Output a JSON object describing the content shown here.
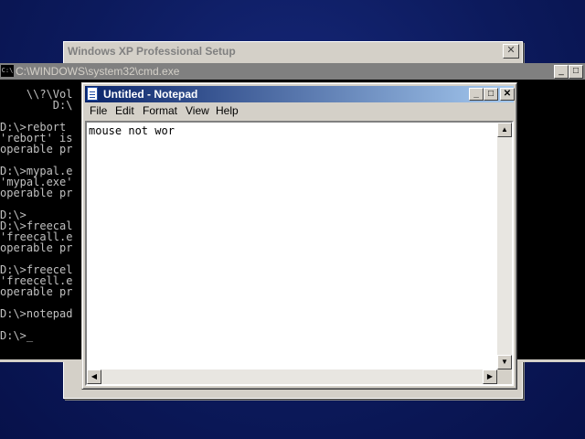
{
  "setup_window": {
    "title": "Windows XP Professional Setup",
    "close_glyph": "✕"
  },
  "cmd_window": {
    "icon_text": "C:\\",
    "title": "C:\\WINDOWS\\system32\\cmd.exe",
    "lines": [
      "    \\\\?\\Vol",
      "        D:\\",
      "",
      "D:\\>rebort",
      "'rebort' is",
      "operable pr",
      "",
      "D:\\>mypal.e",
      "'mypal.exe'",
      "operable pr",
      "",
      "D:\\>",
      "D:\\>freecal",
      "'freecall.e",
      "operable pr",
      "",
      "D:\\>freecel",
      "'freecell.e",
      "operable pr",
      "",
      "D:\\>notepad",
      "",
      "D:\\>_"
    ]
  },
  "notepad": {
    "title": "Untitled - Notepad",
    "menu": [
      "File",
      "Edit",
      "Format",
      "View",
      "Help"
    ],
    "content": "mouse not wor"
  }
}
